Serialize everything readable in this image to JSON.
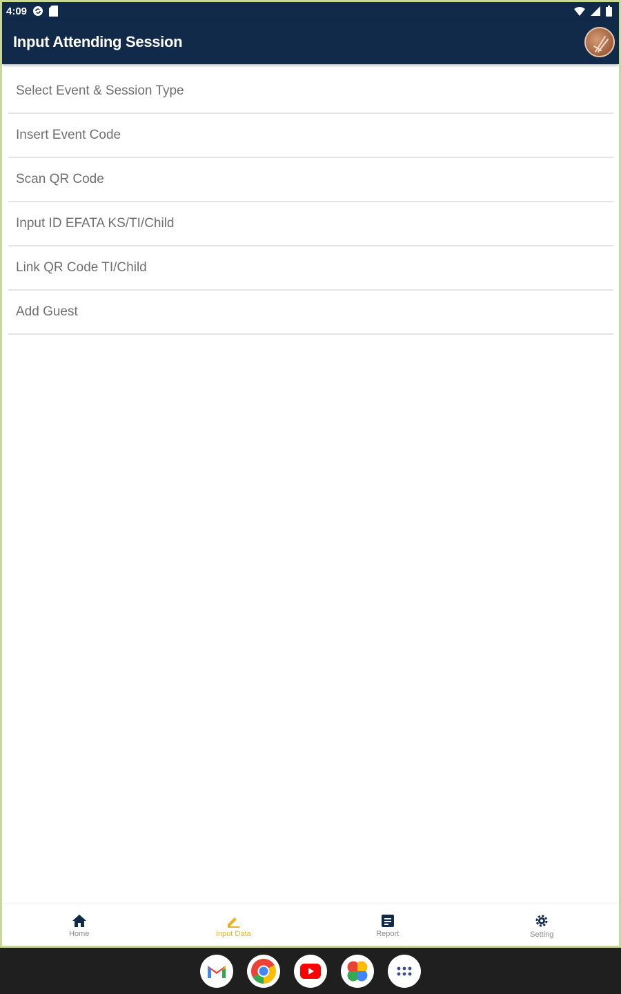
{
  "status_bar": {
    "time": "4:09"
  },
  "app_bar": {
    "title": "Input Attending Session"
  },
  "menu": {
    "items": [
      {
        "label": "Select Event & Session Type"
      },
      {
        "label": "Insert Event Code"
      },
      {
        "label": "Scan QR Code"
      },
      {
        "label": "Input ID EFATA KS/TI/Child"
      },
      {
        "label": "Link QR Code TI/Child"
      },
      {
        "label": "Add Guest"
      }
    ]
  },
  "bottom_nav": {
    "items": [
      {
        "label": "Home",
        "icon": "home-icon"
      },
      {
        "label": "Input Data",
        "icon": "edit-icon",
        "active": true
      },
      {
        "label": "Report",
        "icon": "report-icon"
      },
      {
        "label": "Setting",
        "icon": "gear-icon"
      }
    ]
  },
  "dock": {
    "apps": [
      "gmail-icon",
      "chrome-icon",
      "youtube-icon",
      "photos-icon",
      "app-drawer-icon"
    ]
  },
  "colors": {
    "primary": "#112a4a",
    "accent": "#e8b21f",
    "menu_text": "#6f6f6f"
  }
}
